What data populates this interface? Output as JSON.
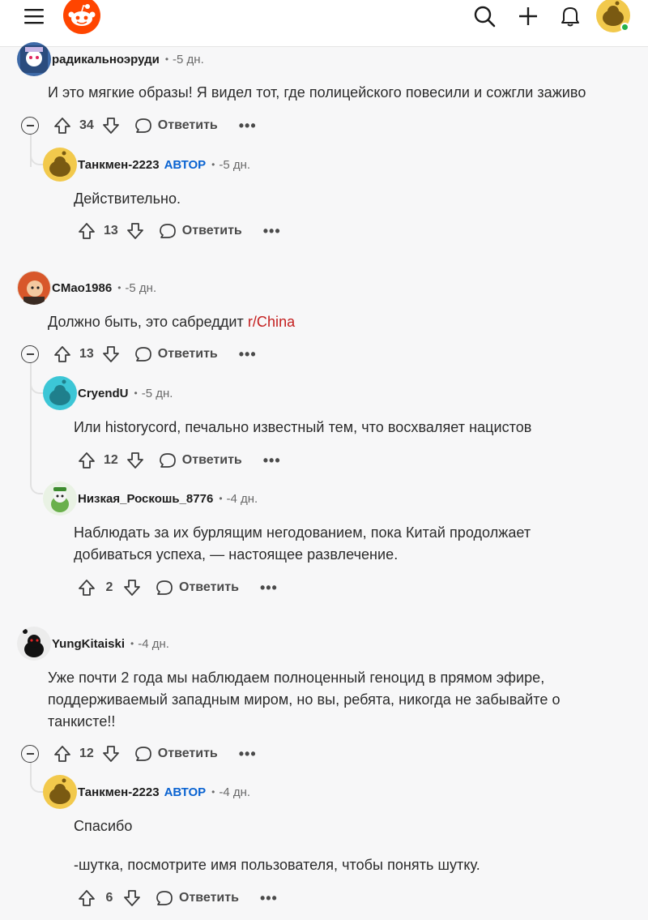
{
  "header": {
    "icons": [
      "menu-icon",
      "reddit-logo",
      "search-icon",
      "plus-icon",
      "bell-icon",
      "user-avatar"
    ]
  },
  "labels": {
    "reply": "Ответить",
    "op": "АВТОР",
    "more": "•••"
  },
  "comments": [
    {
      "user": "радикальноэруди",
      "time": "-5 дн.",
      "op": false,
      "body": "И это мягкие образы! Я видел тот, где полицейского повесили и сожгли заживо",
      "score": "34"
    },
    {
      "user": "Танкмен-2223",
      "time": "-5 дн.",
      "op": true,
      "body": "Действительно.",
      "score": "13"
    },
    {
      "user": "CMao1986",
      "time": "-5 дн.",
      "op": false,
      "body_prefix": "Должно быть, это сабреддит ",
      "body_link": "r/China",
      "score": "13"
    },
    {
      "user": "CryendU",
      "time": "-5 дн.",
      "op": false,
      "body": "Или historycord, печально известный тем, что восхваляет нацистов",
      "score": "12"
    },
    {
      "user": "Низкая_Роскошь_8776",
      "time": "-4 дн.",
      "op": false,
      "body_line1": "Наблюдать за их бурлящим негодованием, пока Китай продолжает",
      "body_line2": "добиваться успеха, — настоящее развлечение.",
      "score": "2"
    },
    {
      "user": "YungKitaiski",
      "time": "-4 дн.",
      "op": false,
      "body_line1": "Уже почти 2 года мы наблюдаем полноценный геноцид в прямом эфире,",
      "body_line2": "поддерживаемый западным миром, но вы, ребята, никогда не забывайте о",
      "body_line3": "танкисте!!",
      "score": "12"
    },
    {
      "user": "Танкмен-2223",
      "time": "-4 дн.",
      "op": true,
      "body_line1": "Спасибо",
      "body_line2": "-шутка, посмотрите имя пользователя, чтобы понять шутку.",
      "score": "6"
    }
  ],
  "colors": {
    "accent": "#ff4500",
    "op_badge": "#0a63d1",
    "link": "#c41e1e",
    "online": "#24b24b"
  }
}
